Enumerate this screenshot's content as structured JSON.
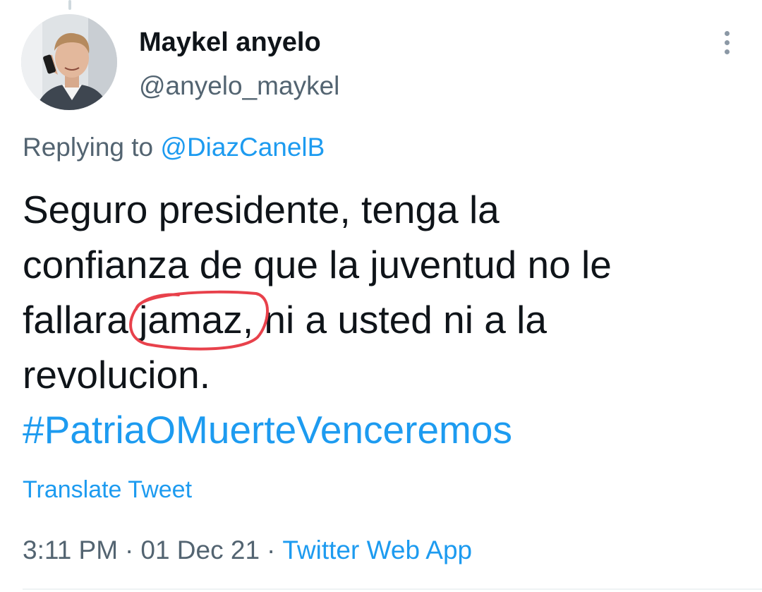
{
  "user": {
    "display_name": "Maykel anyelo",
    "handle": "@anyelo_maykel",
    "avatar_icon": "avatar-photo"
  },
  "more_icon": "more-vertical-icon",
  "reply": {
    "prefix": "Replying to",
    "mention": "@DiazCanelB"
  },
  "tweet": {
    "line1": "Seguro presidente, tenga la",
    "line2": "confianza de que la juventud no le",
    "line3_before": "fallara ",
    "line3_circled": "jamaz",
    "line3_after": ", ni a usted ni a la",
    "line4": "revolucion.",
    "hashtag": "#PatriaOMuerteVenceremos"
  },
  "translate_label": "Translate Tweet",
  "meta": {
    "time": "3:11 PM",
    "date": "01 Dec 21",
    "source": "Twitter Web App",
    "separator": "·"
  },
  "colors": {
    "accent": "#1d9bf0",
    "secondary_text": "#536471",
    "annotation_circle": "#e8414b"
  }
}
